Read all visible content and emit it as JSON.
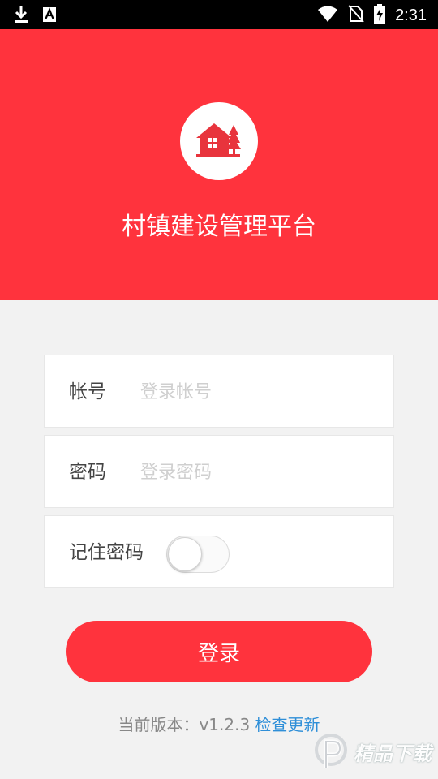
{
  "status_bar": {
    "time": "2:31",
    "icons": [
      "download-icon",
      "a-notification-icon",
      "wifi-icon",
      "no-sim-icon",
      "battery-charging-icon"
    ]
  },
  "header": {
    "title": "村镇建设管理平台",
    "logo": "house-with-tree-icon",
    "background_color": "#ff333d"
  },
  "form": {
    "account": {
      "label": "帐号",
      "placeholder": "登录帐号",
      "value": ""
    },
    "password": {
      "label": "密码",
      "placeholder": "登录密码",
      "value": ""
    },
    "remember": {
      "label": "记住密码",
      "checked": false
    }
  },
  "login_button": {
    "label": "登录"
  },
  "footer": {
    "version_prefix": "当前版本：v1.2.3",
    "check_update": "检查更新"
  },
  "watermark": {
    "text": "精品下载",
    "logo": "p-logo-icon"
  },
  "colors": {
    "accent": "#ff333d",
    "link": "#2f8fd8"
  }
}
